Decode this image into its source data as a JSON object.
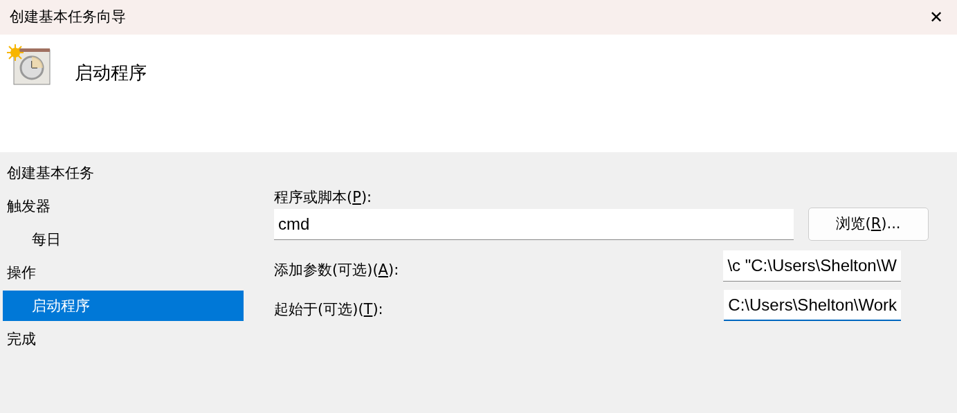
{
  "window": {
    "title": "创建基本任务向导",
    "close": "✕"
  },
  "header": {
    "title": "启动程序"
  },
  "steps": [
    {
      "label": "创建基本任务",
      "selected": false
    },
    {
      "label": "触发器",
      "selected": false,
      "children": [
        {
          "label": "每日",
          "selected": false
        }
      ]
    },
    {
      "label": "操作",
      "selected": false,
      "children": [
        {
          "label": "启动程序",
          "selected": true
        }
      ]
    },
    {
      "label": "完成",
      "selected": false
    }
  ],
  "program": {
    "label": "程序或脚本(",
    "key": "P",
    "suffix": "):",
    "value": "cmd",
    "focused": false
  },
  "browse_button": {
    "label": "浏览(",
    "key": "R",
    "suffix": ")..."
  },
  "fields": [
    {
      "label": "添加参数(可选)(",
      "key": "A",
      "suffix": "):",
      "value": "\\c \"C:\\Users\\Shelton\\W",
      "focused": false
    },
    {
      "label": "起始于(可选)(",
      "key": "T",
      "suffix": "):",
      "value": "C:\\Users\\Shelton\\Work",
      "focused": true
    }
  ]
}
